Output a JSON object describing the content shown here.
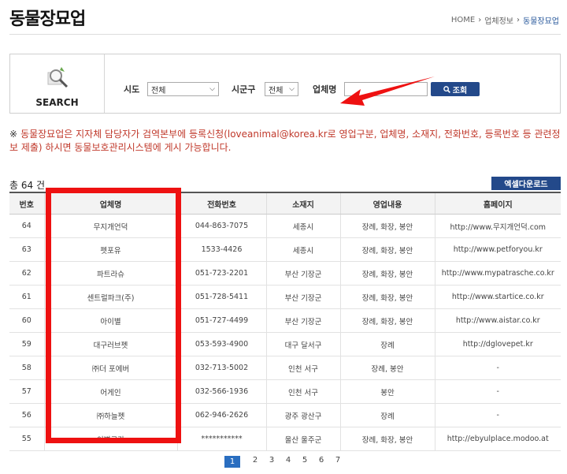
{
  "page": {
    "title": "동물장묘업"
  },
  "breadcrumb": {
    "home": "HOME",
    "level1": "업체정보",
    "level2": "동물장묘업"
  },
  "search": {
    "label": "SEARCH",
    "sido_label": "시도",
    "sido_value": "전체",
    "sigungu_label": "시군구",
    "sigungu_value": "전체",
    "name_label": "업체명",
    "name_value": "",
    "button_label": "조회"
  },
  "notice": {
    "mark": "※",
    "text": "동물장묘업은 지자체 담당자가 검역본부에 등록신청(loveanimal@korea.kr로 영업구분, 업체명, 소재지, 전화번호, 등록번호 등 관련정보 제출) 하시면 동물보호관리시스템에 게시 가능합니다."
  },
  "results": {
    "total": "총 64 건",
    "excel_label": "엑셀다운로드"
  },
  "table": {
    "headers": [
      "번호",
      "업체명",
      "전화번호",
      "소재지",
      "영업내용",
      "홈페이지"
    ],
    "rows": [
      [
        "64",
        "무지개언덕",
        "044-863-7075",
        "세종시",
        "장례, 화장, 봉안",
        "http://www.무지개언덕.com"
      ],
      [
        "63",
        "펫포유",
        "1533-4426",
        "세종시",
        "장례, 화장, 봉안",
        "http://www.petforyou.kr"
      ],
      [
        "62",
        "파트라슈",
        "051-723-2201",
        "부산 기장군",
        "장례, 화장, 봉안",
        "http://www.mypatrasche.co.kr"
      ],
      [
        "61",
        "센트럴파크(주)",
        "051-728-5411",
        "부산 기장군",
        "장례, 화장, 봉안",
        "http://www.startice.co.kr"
      ],
      [
        "60",
        "아이별",
        "051-727-4499",
        "부산 기장군",
        "장례, 화장, 봉안",
        "http://www.aistar.co.kr"
      ],
      [
        "59",
        "대구러브펫",
        "053-593-4900",
        "대구 달서구",
        "장례",
        "http://dglovepet.kr"
      ],
      [
        "58",
        "㈜더 포에버",
        "032-713-5002",
        "인천 서구",
        "장례, 봉안",
        "-"
      ],
      [
        "57",
        "어게인",
        "032-566-1936",
        "인천 서구",
        "봉안",
        "-"
      ],
      [
        "56",
        "㈜하늘펫",
        "062-946-2626",
        "광주 광산구",
        "장례",
        "-"
      ],
      [
        "55",
        "이별공간",
        "***********",
        "울산 울주군",
        "장례, 화장, 봉안",
        "http://ebyulplace.modoo.at"
      ]
    ]
  },
  "pagination": {
    "pages": [
      "1",
      "2",
      "3",
      "4",
      "5",
      "6",
      "7"
    ],
    "active": "1"
  },
  "colors": {
    "primary": "#23498a",
    "highlight": "#ee1111",
    "notice": "#c0392b",
    "arrow": "#ee1111"
  },
  "icons": {
    "search_graphic": "magnifier-icon",
    "button": "search-icon",
    "chevron": "chevron-down-icon",
    "annotation": "arrow-icon"
  }
}
